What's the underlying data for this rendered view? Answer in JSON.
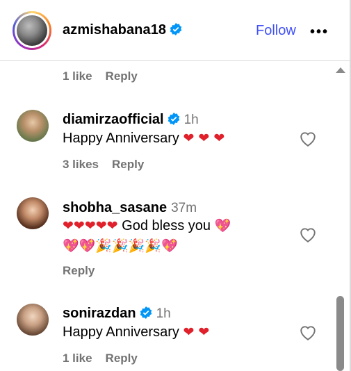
{
  "post": {
    "username": "azmishabana18",
    "follow_label": "Follow",
    "more_label": "•••"
  },
  "top_meta": {
    "likes": "1 like",
    "reply": "Reply"
  },
  "comments": [
    {
      "username": "diamirzaofficial",
      "verified": true,
      "time": "1h",
      "text": "Happy Anniversary",
      "emojis": "❤ ❤ ❤",
      "likes": "3 likes",
      "reply": "Reply"
    },
    {
      "username": "shobha_sasane",
      "verified": false,
      "time": "37m",
      "line1_hearts": "❤❤❤❤❤",
      "line1_text": "God bless you",
      "line1_trailing": "💖",
      "line2": "💖💖🎉🎉🎉🎉💖",
      "reply": "Reply"
    },
    {
      "username": "sonirazdan",
      "verified": true,
      "time": "1h",
      "text": "Happy Anniversary",
      "emojis": "❤ ❤",
      "likes": "1 like",
      "reply": "Reply"
    }
  ],
  "colors": {
    "follow": "#4150f7",
    "verified": "#0095f6",
    "muted": "#737373",
    "heart": "#e0202a"
  },
  "icons": [
    "verified-badge-icon",
    "more-options-icon",
    "like-heart-icon",
    "scroll-up-arrow-icon"
  ]
}
